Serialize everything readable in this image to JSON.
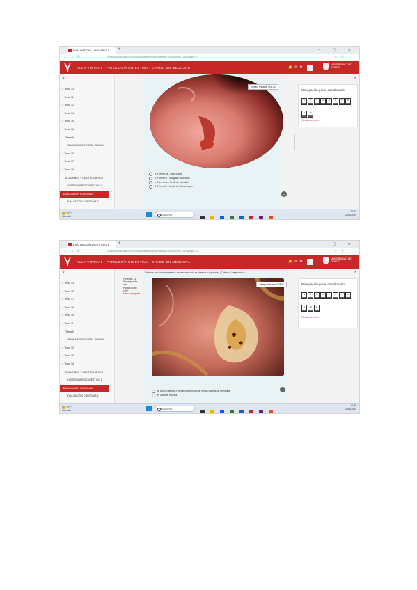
{
  "browser": {
    "tab_title": "EVALUATION ... USUARIO 1",
    "tab_title_2": "EVALUACIÓN DIGESTIVO 1",
    "url_1": "campusvirtual.uniovi.es/mod/quiz/attempt.php?attempt=2843&cmid=1290&page=12",
    "url_2": "campusvirtual.uniovi.es/mod/quiz/attempt.php?attempt=2843&cmid=1290&page=13"
  },
  "site": {
    "title": "AULA VIRTUAL · PATOLOGÍA DIGESTIVA · GRADO EN MEDICINA",
    "university": "UNIVERSIDAD DE OVIEDO",
    "accent": "#c62828"
  },
  "sidebar": {
    "items_1": [
      {
        "label": "Tema 13",
        "chev": "›"
      },
      {
        "label": "Tema 11",
        "chev": "›"
      },
      {
        "label": "Tema 12",
        "chev": "›"
      },
      {
        "label": "Tema 14",
        "chev": "›"
      },
      {
        "label": "Tema 15",
        "chev": "›"
      },
      {
        "label": "Tema 16",
        "chev": "›"
      },
      {
        "label": "Tema 9",
        "chev": "⌄"
      },
      {
        "label": "SEMINARIO INTEGRAL TEMA 9",
        "chev": "",
        "sub": true
      },
      {
        "label": "Tema 10",
        "chev": "›"
      },
      {
        "label": "Tema 17",
        "chev": "›"
      },
      {
        "label": "Tema 18",
        "chev": "›"
      },
      {
        "label": "EXÁMENES Y CUESTIONARIOS",
        "chev": "⌄"
      },
      {
        "label": "CUESTIONARIO DIGESTIVO 1",
        "chev": "",
        "sub": true
      },
      {
        "label": "EVALUACIÓN CONTINUA",
        "chev": "",
        "active": true
      },
      {
        "label": "EVALUACIÓN CONTINUA 2",
        "chev": "",
        "sub": true
      }
    ],
    "items_2": [
      {
        "label": "Tema 13",
        "chev": "›"
      },
      {
        "label": "Tema 15",
        "chev": "›"
      },
      {
        "label": "Tema 17",
        "chev": "›"
      },
      {
        "label": "Tema 18",
        "chev": "›"
      },
      {
        "label": "Tema 19",
        "chev": "›"
      },
      {
        "label": "Tema 11",
        "chev": "›"
      },
      {
        "label": "Tema 9",
        "chev": "⌄"
      },
      {
        "label": "SEMINARIO INTEGRAL TEMA 9",
        "chev": "",
        "sub": true
      },
      {
        "label": "Tema 12",
        "chev": "›"
      },
      {
        "label": "Tema 10",
        "chev": "›"
      },
      {
        "label": "Tema 14",
        "chev": "›"
      },
      {
        "label": "EXÁMENES Y CUESTIONARIOS",
        "chev": "⌄"
      },
      {
        "label": "CUESTIONARIO DIGESTIVO 1",
        "chev": "",
        "sub": true
      },
      {
        "label": "EVALUACIÓN CONTINUA",
        "chev": "",
        "active": true
      },
      {
        "label": "EVALUACIÓN CONTINUA 2",
        "chev": "",
        "sub": true
      }
    ]
  },
  "quiz1": {
    "time_left": "Tiempo restante 0:08:50",
    "options": [
      {
        "letter": "a.",
        "text": "Forrest IIa - vaso visible"
      },
      {
        "letter": "b.",
        "text": "Forrest Ib - sangrado babeante"
      },
      {
        "letter": "c.",
        "text": "Forrest IIc - fondo de hematina"
      },
      {
        "letter": "d.",
        "text": "Forrest III - fondo de fibrina limpio"
      }
    ]
  },
  "quiz2": {
    "qinfo": [
      "Pregunta 13",
      "Sin responder aún",
      "Puntúa como 1,00",
      "Marcar pregunta"
    ],
    "question": "Paciente con dolor epigástrico; en la endoscopia se observa lo siguiente. ¿Cuál es el diagnóstico?",
    "time_left": "Tiempo restante 0:08:06",
    "options": [
      {
        "letter": "a.",
        "text": "Úlcera gástrica Forrest III con fondo de fibrina y áreas de hematina"
      },
      {
        "letter": "b.",
        "text": "Gastritis erosiva"
      }
    ]
  },
  "navigation": {
    "title": "Navegación por el cuestionario",
    "buttons_1": [
      "1",
      "2",
      "3",
      "4",
      "5",
      "6",
      "7",
      "8",
      "9",
      "10"
    ],
    "buttons_2": [
      "1",
      "2",
      "3",
      "4",
      "5",
      "6",
      "7",
      "8",
      "9",
      "10",
      "11"
    ],
    "finish_label": "Terminar intento..."
  },
  "taskbar": {
    "weather_temp": "16°C",
    "weather_desc": "Soleado",
    "search_placeholder": "Búsqueda",
    "time": "10:37",
    "date": "12/03/2024",
    "time_2": "10:38",
    "date_2": "12/03/2024"
  }
}
